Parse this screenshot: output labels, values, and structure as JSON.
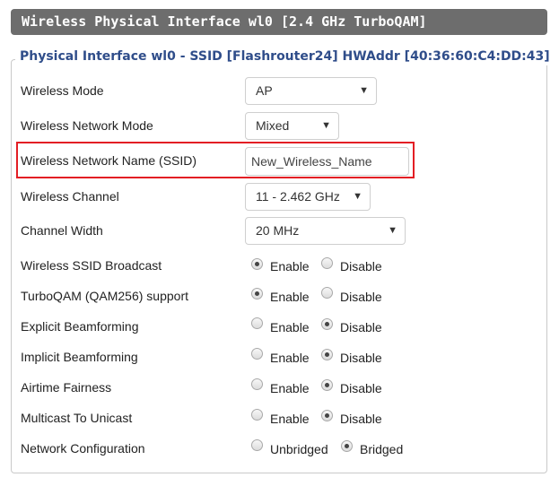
{
  "header": {
    "title": "Wireless Physical Interface wl0 [2.4 GHz TurboQAM]"
  },
  "legend": "Physical Interface wl0 - SSID [Flashrouter24] HWAddr [40:36:60:C4:DD:43]",
  "fields": {
    "wireless_mode": {
      "label": "Wireless Mode",
      "value": "AP"
    },
    "network_mode": {
      "label": "Wireless Network Mode",
      "value": "Mixed"
    },
    "ssid": {
      "label": "Wireless Network Name (SSID)",
      "value": "New_Wireless_Name"
    },
    "channel": {
      "label": "Wireless Channel",
      "value": "11 - 2.462 GHz"
    },
    "channel_width": {
      "label": "Channel Width",
      "value": "20 MHz"
    }
  },
  "radio_options": {
    "enable": "Enable",
    "disable": "Disable",
    "unbridged": "Unbridged",
    "bridged": "Bridged"
  },
  "radios": [
    {
      "label": "Wireless SSID Broadcast",
      "selected": "Enable"
    },
    {
      "label": "TurboQAM (QAM256) support",
      "selected": "Enable"
    },
    {
      "label": "Explicit Beamforming",
      "selected": "Disable"
    },
    {
      "label": "Implicit Beamforming",
      "selected": "Disable"
    },
    {
      "label": "Airtime Fairness",
      "selected": "Disable"
    },
    {
      "label": "Multicast To Unicast",
      "selected": "Disable"
    },
    {
      "label": "Network Configuration",
      "selected": "Bridged"
    }
  ],
  "highlight_color": "#e31e24"
}
